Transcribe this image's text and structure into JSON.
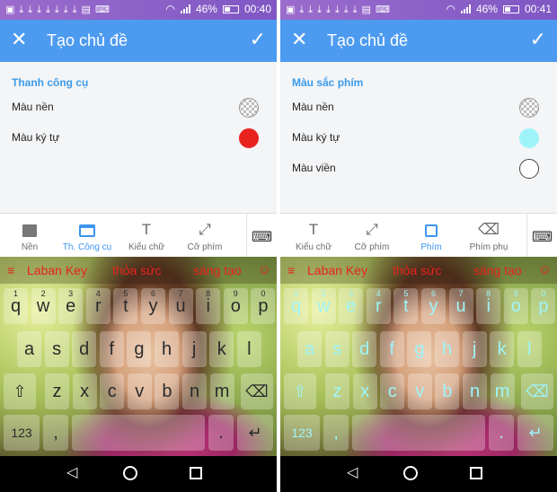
{
  "left": {
    "status": {
      "battery": "46%",
      "time": "00:40",
      "battery_level": 0.46
    },
    "appbar": {
      "title": "Tạo chủ đề"
    },
    "section_title": "Thanh công cụ",
    "rows": [
      {
        "label": "Màu nền",
        "swatch": "transparent"
      },
      {
        "label": "Màu ký tự",
        "swatch": "#e8231f"
      }
    ],
    "tabs": [
      {
        "label": "Nền",
        "icon": "image-icon"
      },
      {
        "label": "Th. Công cụ",
        "icon": "toolbar-icon",
        "active": true
      },
      {
        "label": "Kiểu chữ",
        "icon": "font-icon"
      },
      {
        "label": "Cỡ phím",
        "icon": "resize-icon"
      }
    ],
    "keyboard": {
      "label_color": "#e8231f",
      "key_color": "#2b2b2b",
      "suggestions": [
        "Laban Key",
        "thỏa sức",
        "sáng tạo"
      ],
      "hints": [
        "1",
        "2",
        "3",
        "4",
        "5",
        "6",
        "7",
        "8",
        "9",
        "0"
      ],
      "row1": [
        "q",
        "w",
        "e",
        "r",
        "t",
        "y",
        "u",
        "i",
        "o",
        "p"
      ],
      "row2": [
        "a",
        "s",
        "d",
        "f",
        "g",
        "h",
        "j",
        "k",
        "l"
      ],
      "row3": [
        "z",
        "x",
        "c",
        "v",
        "b",
        "n",
        "m"
      ],
      "num_label": "123",
      "comma": ",",
      "period": "."
    }
  },
  "right": {
    "status": {
      "battery": "46%",
      "time": "00:41",
      "battery_level": 0.46
    },
    "appbar": {
      "title": "Tạo chủ đề"
    },
    "section_title": "Màu sắc phím",
    "rows": [
      {
        "label": "Màu nền",
        "swatch": "transparent"
      },
      {
        "label": "Màu ký tự",
        "swatch": "#9ff4f9"
      },
      {
        "label": "Màu viền",
        "swatch": "#ffffff"
      }
    ],
    "tabs": [
      {
        "label": "Kiểu chữ",
        "icon": "font-icon"
      },
      {
        "label": "Cỡ phím",
        "icon": "resize-icon"
      },
      {
        "label": "Phím",
        "icon": "key-icon",
        "active": true
      },
      {
        "label": "Phím phụ",
        "icon": "backspace-icon"
      }
    ],
    "keyboard": {
      "label_color": "#e8231f",
      "key_color": "#9ff4f9",
      "suggestions": [
        "Laban Key",
        "thỏa sức",
        "sáng tạo"
      ],
      "hints": [
        "1",
        "2",
        "3",
        "4",
        "5",
        "6",
        "7",
        "8",
        "9",
        "0"
      ],
      "row1": [
        "q",
        "w",
        "e",
        "r",
        "t",
        "y",
        "u",
        "i",
        "o",
        "p"
      ],
      "row2": [
        "a",
        "s",
        "d",
        "f",
        "g",
        "h",
        "j",
        "k",
        "l"
      ],
      "row3": [
        "z",
        "x",
        "c",
        "v",
        "b",
        "n",
        "m"
      ],
      "num_label": "123",
      "comma": ",",
      "period": "."
    }
  }
}
